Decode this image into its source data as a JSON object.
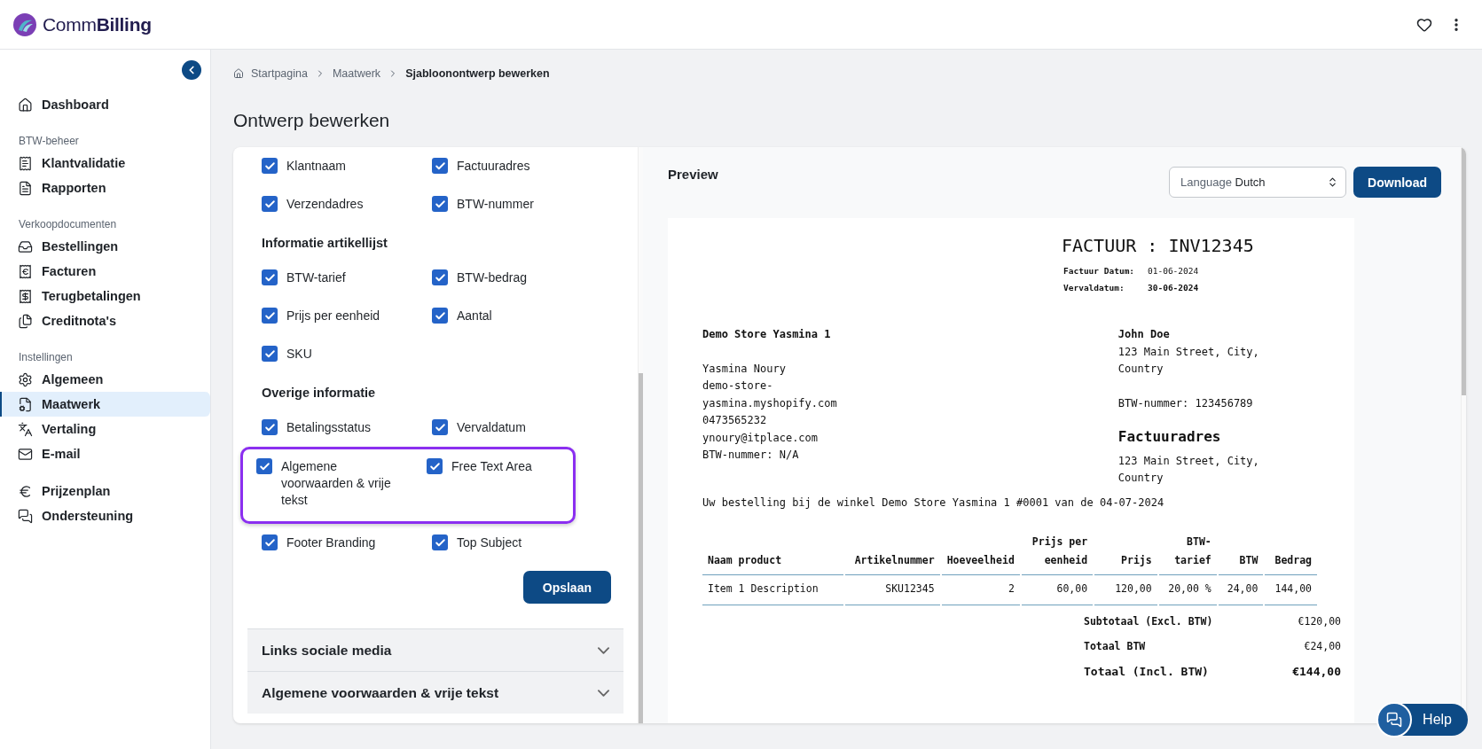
{
  "app": {
    "name_light": "Comm",
    "name_bold": "Billing"
  },
  "sidebar": {
    "groups": [
      {
        "items": [
          {
            "label": "Dashboard",
            "selected": false
          }
        ]
      },
      {
        "label": "BTW-beheer",
        "items": [
          {
            "label": "Klantvalidatie",
            "selected": false
          },
          {
            "label": "Rapporten",
            "selected": false
          }
        ]
      },
      {
        "label": "Verkoopdocumenten",
        "items": [
          {
            "label": "Bestellingen",
            "selected": false
          },
          {
            "label": "Facturen",
            "selected": false
          },
          {
            "label": "Terugbetalingen",
            "selected": false
          },
          {
            "label": "Creditnota's",
            "selected": false
          }
        ]
      },
      {
        "label": "Instellingen",
        "items": [
          {
            "label": "Algemeen",
            "selected": false
          },
          {
            "label": "Maatwerk",
            "selected": true
          },
          {
            "label": "Vertaling",
            "selected": false
          },
          {
            "label": "E-mail",
            "selected": false
          }
        ]
      },
      {
        "items": [
          {
            "label": "Prijzenplan",
            "selected": false
          },
          {
            "label": "Ondersteuning",
            "selected": false
          }
        ]
      }
    ]
  },
  "breadcrumb": [
    "Startpagina",
    "Maatwerk",
    "Sjabloonontwerp bewerken"
  ],
  "page_title": "Ontwerp bewerken",
  "options": {
    "sections": [
      {
        "rows": [
          {
            "highlighted": false,
            "items": [
              {
                "label": "Klantnaam",
                "checked": true
              },
              {
                "label": "Factuuradres",
                "checked": true
              }
            ]
          },
          {
            "highlighted": false,
            "items": [
              {
                "label": "Verzendadres",
                "checked": true
              },
              {
                "label": "BTW-nummer",
                "checked": true
              }
            ]
          }
        ]
      },
      {
        "title": "Informatie artikellijst",
        "rows": [
          {
            "highlighted": false,
            "items": [
              {
                "label": "BTW-tarief",
                "checked": true
              },
              {
                "label": "BTW-bedrag",
                "checked": true
              }
            ]
          },
          {
            "highlighted": false,
            "items": [
              {
                "label": "Prijs per eenheid",
                "checked": true
              },
              {
                "label": "Aantal",
                "checked": true
              }
            ]
          },
          {
            "highlighted": false,
            "items": [
              {
                "label": "SKU",
                "checked": true
              }
            ]
          }
        ]
      },
      {
        "title": "Overige informatie",
        "rows": [
          {
            "highlighted": false,
            "items": [
              {
                "label": "Betalingsstatus",
                "checked": true
              },
              {
                "label": "Vervaldatum",
                "checked": true
              }
            ]
          },
          {
            "highlighted": true,
            "items": [
              {
                "label": "Algemene voorwaarden & vrije tekst",
                "checked": true
              },
              {
                "label": "Free Text Area",
                "checked": true
              }
            ]
          },
          {
            "highlighted": false,
            "items": [
              {
                "label": "Footer Branding",
                "checked": true
              },
              {
                "label": "Top Subject",
                "checked": true
              }
            ]
          }
        ]
      }
    ],
    "save_button": "Opslaan"
  },
  "accordions": [
    {
      "title": "Links sociale media",
      "expanded": false
    },
    {
      "title": "Algemene voorwaarden & vrije tekst",
      "expanded": false
    }
  ],
  "preview": {
    "title": "Preview",
    "language": {
      "label": "Language",
      "value": "Dutch"
    },
    "download_button": "Download",
    "invoice": {
      "title": "FACTUUR : INV12345",
      "meta": [
        {
          "label": "Factuur Datum:",
          "value": "01-06-2024",
          "bold": false
        },
        {
          "label": "Vervaldatum:",
          "value": "30-06-2024",
          "bold": true
        }
      ],
      "seller": {
        "name": "Demo Store Yasmina 1",
        "lines": [
          "Yasmina Noury",
          "demo-store-yasmina.myshopify.com",
          "0473565232",
          "ynoury@itplace.com",
          "BTW-nummer: N/A"
        ]
      },
      "customer": {
        "name": "John Doe",
        "address": "123 Main Street, City, Country",
        "vat": "BTW-nummer: 123456789",
        "billing_title": "Factuuradres",
        "billing_address": "123 Main Street, City, Country"
      },
      "order_line": "Uw bestelling bij de winkel Demo Store Yasmina 1 #0001 van de 04-07-2024",
      "columns": [
        "Naam product",
        "Artikelnummer",
        "Hoeveelheid",
        "Prijs per eenheid",
        "Prijs",
        "BTW-tarief",
        "BTW",
        "Bedrag"
      ],
      "rows": [
        [
          "Item 1 Description",
          "SKU12345",
          "2",
          "60,00",
          "120,00",
          "20,00 %",
          "24,00",
          "144,00"
        ]
      ],
      "totals": [
        {
          "label": "Subtotaal (Excl. BTW)",
          "value": "€120,00",
          "emphasis": false
        },
        {
          "label": "Totaal BTW",
          "value": "€24,00",
          "emphasis": false
        },
        {
          "label": "Totaal (Incl. BTW)",
          "value": "€144,00",
          "emphasis": true
        }
      ]
    }
  },
  "help_button": "Help"
}
